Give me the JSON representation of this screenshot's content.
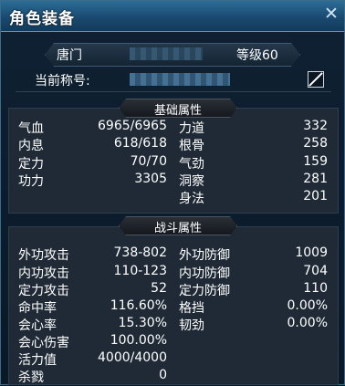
{
  "window": {
    "title": "角色装备"
  },
  "header": {
    "sect": "唐门",
    "level_label": "等级60",
    "title_label": "当前称号:"
  },
  "basic": {
    "heading": "基础属性",
    "left": [
      {
        "label": "气血",
        "value": "6965/6965"
      },
      {
        "label": "内息",
        "value": "618/618"
      },
      {
        "label": "定力",
        "value": "70/70"
      },
      {
        "label": "功力",
        "value": "3305"
      }
    ],
    "right": [
      {
        "label": "力道",
        "value": "332"
      },
      {
        "label": "根骨",
        "value": "258"
      },
      {
        "label": "气劲",
        "value": "159"
      },
      {
        "label": "洞察",
        "value": "281"
      },
      {
        "label": "身法",
        "value": "201"
      }
    ]
  },
  "combat": {
    "heading": "战斗属性",
    "left": [
      {
        "label": "外功攻击",
        "value": "738-802"
      },
      {
        "label": "内功攻击",
        "value": "110-123"
      },
      {
        "label": "定力攻击",
        "value": "52"
      },
      {
        "label": "命中率",
        "value": "116.60%"
      },
      {
        "label": "会心率",
        "value": "15.30%"
      },
      {
        "label": "会心伤害",
        "value": "100.00%"
      },
      {
        "label": "活力值",
        "value": "4000/4000"
      },
      {
        "label": "杀戮",
        "value": "0"
      }
    ],
    "right": [
      {
        "label": "外功防御",
        "value": "1009"
      },
      {
        "label": "内功防御",
        "value": "704"
      },
      {
        "label": "定力防御",
        "value": "110"
      },
      {
        "label": "格挡",
        "value": "0.00%"
      },
      {
        "label": "韧劲",
        "value": "0.00%"
      }
    ]
  }
}
